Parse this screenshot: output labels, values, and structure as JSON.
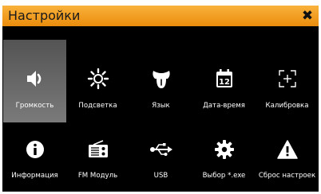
{
  "window": {
    "title": "Настройки"
  },
  "items": [
    {
      "label": "Громкость",
      "icon": "speaker-icon",
      "selected": true
    },
    {
      "label": "Подсветка",
      "icon": "sun-icon",
      "selected": false
    },
    {
      "label": "Язык",
      "icon": "tongue-icon",
      "selected": false
    },
    {
      "label": "Дата-время",
      "icon": "calendar-icon",
      "day": "12",
      "selected": false
    },
    {
      "label": "Калибровка",
      "icon": "crosshair-icon",
      "selected": false
    },
    {
      "label": "Информация",
      "icon": "info-icon",
      "selected": false
    },
    {
      "label": "FM Модуль",
      "icon": "radio-icon",
      "selected": false
    },
    {
      "label": "USB",
      "icon": "usb-icon",
      "selected": false
    },
    {
      "label": "Выбор *.exe",
      "icon": "gear-icon",
      "selected": false
    },
    {
      "label": "Сброс настроек",
      "icon": "warning-icon",
      "selected": false
    }
  ],
  "colors": {
    "titlebar_top": "#f9b23c",
    "titlebar_bottom": "#eb8c0c",
    "selected_tile": "#6a6a6a"
  }
}
